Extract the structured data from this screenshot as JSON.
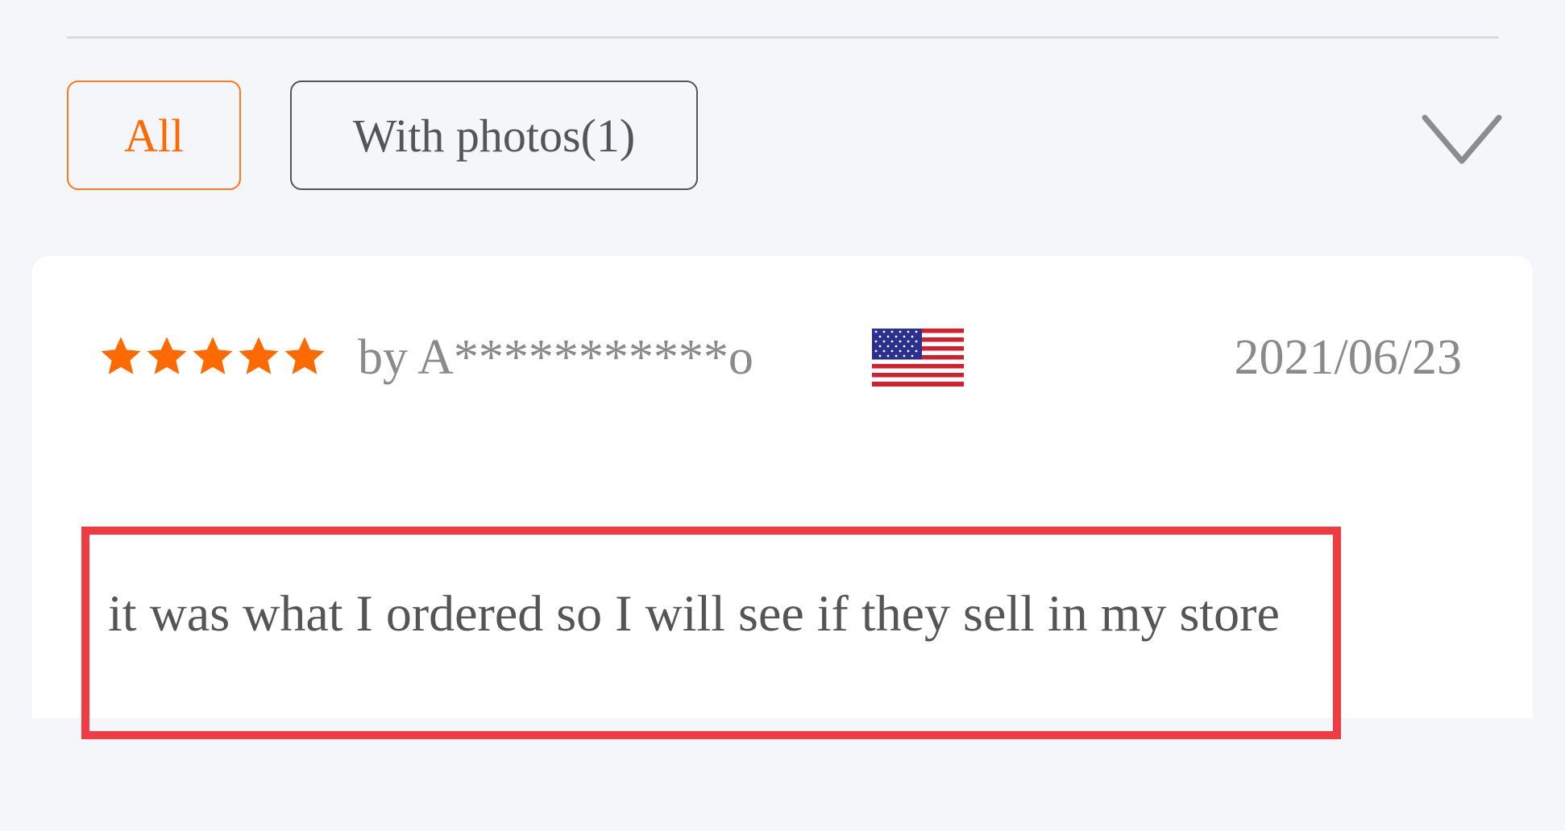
{
  "filters": {
    "all_label": "All",
    "with_photos_label": "With photos(1)",
    "expand_icon": "chevron-down-icon"
  },
  "review": {
    "rating": 5,
    "rating_max": 5,
    "reviewer": "by A***********o",
    "country_flag_icon": "us-flag-icon",
    "date": "2021/06/23",
    "text": "it was what I ordered so I will see if they sell in my store"
  },
  "colors": {
    "accent": "#ff6a00",
    "highlight_border": "#ef3b42",
    "muted_text": "#8a8a8a",
    "body_text": "#555555",
    "page_bg": "#f5f6fa",
    "card_bg": "#ffffff"
  }
}
